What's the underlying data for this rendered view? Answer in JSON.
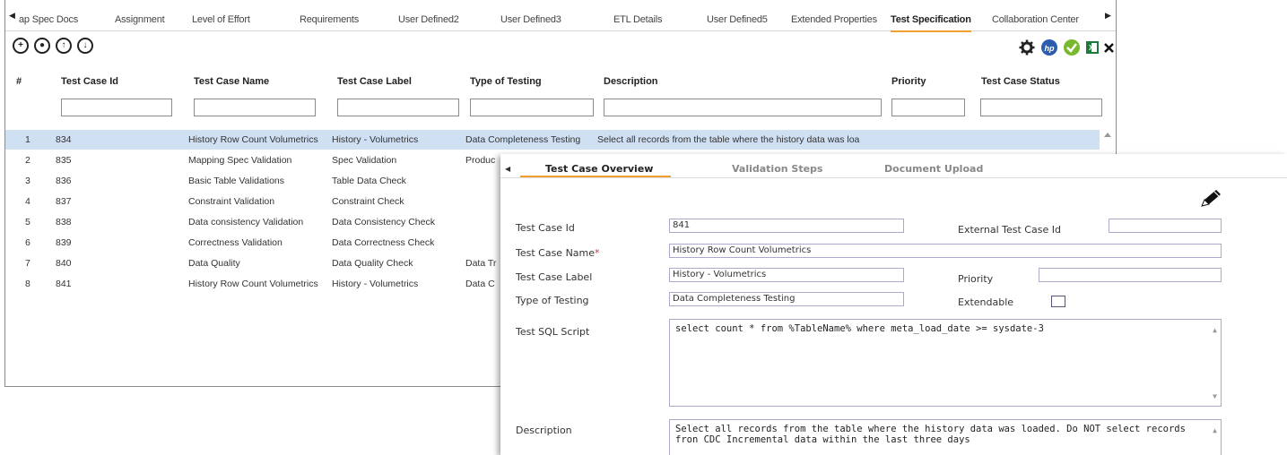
{
  "tabs": [
    "ap Spec Docs",
    "Assignment",
    "Level of Effort",
    "Requirements",
    "User Defined2",
    "User Defined3",
    "ETL Details",
    "User Defined5",
    "Extended Properties",
    "Test Specification",
    "Collaboration Center"
  ],
  "active_tab": "Test Specification",
  "toolbar": {
    "left_icons": [
      "add-icon",
      "delete-icon",
      "move-up-icon",
      "move-down-icon"
    ],
    "right_icons": [
      "settings-gear-icon",
      "hp-alm-icon",
      "checkmark-icon",
      "excel-export-icon",
      "close-icon"
    ]
  },
  "grid": {
    "headers": [
      "#",
      "Test Case Id",
      "Test Case Name",
      "Test Case Label",
      "Type of Testing",
      "Description",
      "Priority",
      "Test Case Status"
    ],
    "rows": [
      {
        "num": "1",
        "id": "834",
        "name": "History Row Count Volumetrics",
        "label": "History - Volumetrics",
        "type": "Data Completeness Testing",
        "desc": "Select all records from the table where the history data was loa"
      },
      {
        "num": "2",
        "id": "835",
        "name": "Mapping Spec Validation",
        "label": "Spec Validation",
        "type": "Produc",
        "desc": ""
      },
      {
        "num": "3",
        "id": "836",
        "name": "Basic Table Validations",
        "label": "Table Data Check",
        "type": "",
        "desc": ""
      },
      {
        "num": "4",
        "id": "837",
        "name": "Constraint Validation",
        "label": "Constraint Check",
        "type": "",
        "desc": ""
      },
      {
        "num": "5",
        "id": "838",
        "name": "Data consistency Validation",
        "label": "Data Consistency Check",
        "type": "",
        "desc": ""
      },
      {
        "num": "6",
        "id": "839",
        "name": "Correctness Validation",
        "label": "Data Correctness Check",
        "type": "",
        "desc": ""
      },
      {
        "num": "7",
        "id": "840",
        "name": "Data Quality",
        "label": "Data Quality Check",
        "type": "Data Tr",
        "desc": ""
      },
      {
        "num": "8",
        "id": "841",
        "name": "History Row Count Volumetrics",
        "label": "History - Volumetrics",
        "type": "Data C",
        "desc": ""
      }
    ]
  },
  "detail": {
    "tabs": [
      "Test Case Overview",
      "Validation Steps",
      "Document Upload"
    ],
    "edit_icon": "pencil-edit-icon",
    "labels": {
      "id": "Test Case Id",
      "name": "Test Case Name",
      "label": "Test Case Label",
      "type": "Type of Testing",
      "sql": "Test SQL Script",
      "desc": "Description",
      "ext_id": "External Test Case Id",
      "priority": "Priority",
      "extendable": "Extendable"
    },
    "required_mark": "*",
    "values": {
      "id": "841",
      "name": "History Row Count Volumetrics",
      "label": "History - Volumetrics",
      "type": "Data Completeness Testing",
      "ext_id": "",
      "priority": "",
      "sql": "select count * from %TableName% where meta_load_date >= sysdate-3",
      "desc": "Select all records from the table where the history data was loaded. Do NOT select records fron CDC Incremental data within the last three days"
    }
  }
}
